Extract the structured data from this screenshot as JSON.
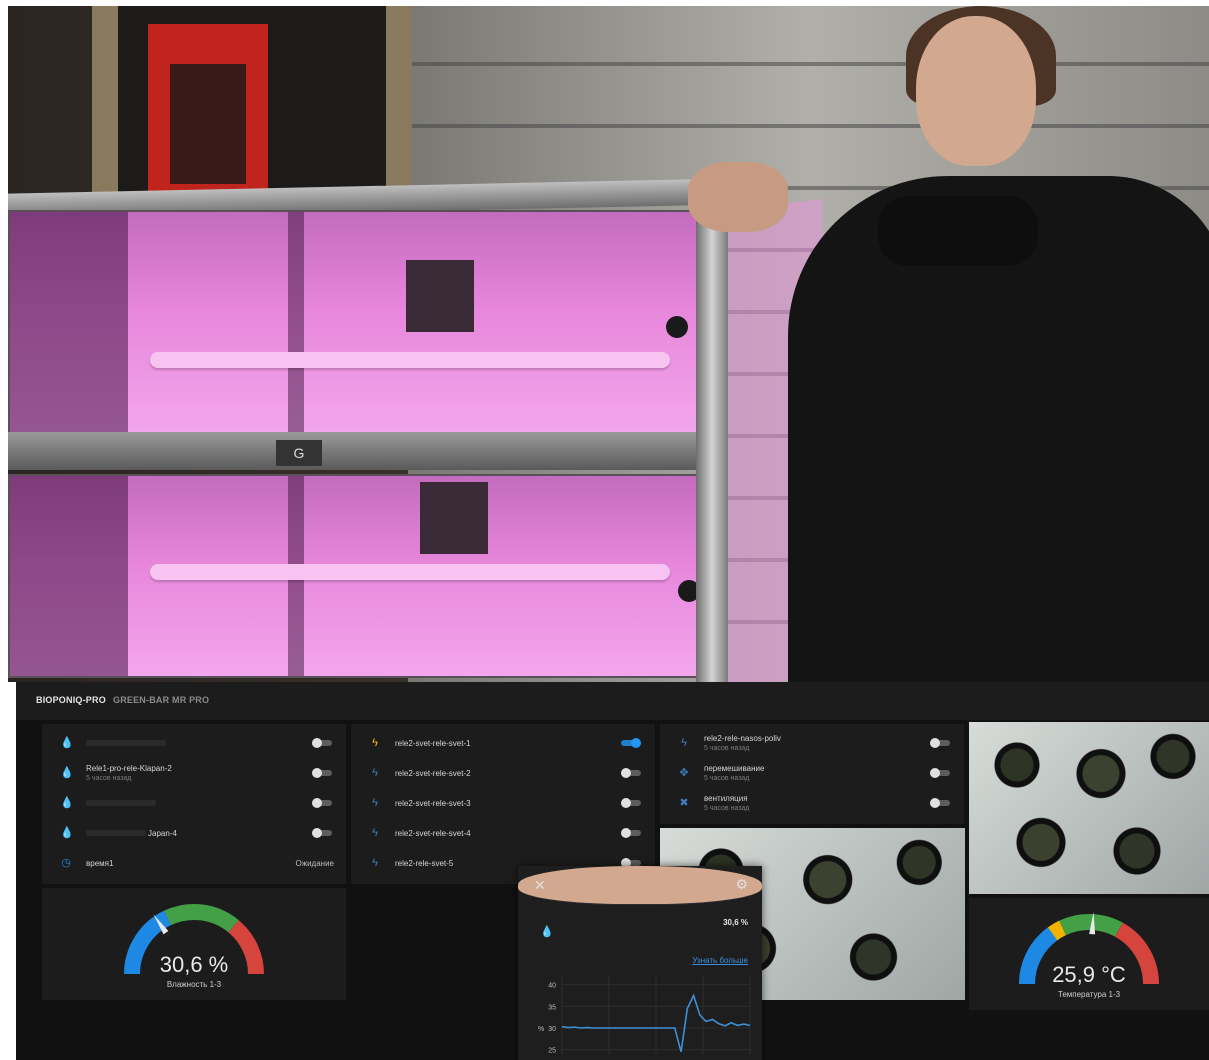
{
  "tabs": [
    "BIOPONIQ-PRO",
    "GREEN-BAR MR PRO"
  ],
  "card1": {
    "rows": [
      {
        "name": "",
        "sub": "",
        "icon": "water-drop-icon",
        "on": false
      },
      {
        "name": "Rele1-pro-rele-Klapan-2",
        "sub": "5 часов назад",
        "icon": "water-drop-icon",
        "on": false
      },
      {
        "name": "",
        "sub": "",
        "icon": "water-drop-icon",
        "on": false
      },
      {
        "name": "Japan-4",
        "sub": "",
        "icon": "water-drop-icon",
        "on": false
      }
    ],
    "timer": {
      "name": "время1",
      "state": "Ожидание",
      "icon": "timer-icon"
    }
  },
  "card2": {
    "rows": [
      {
        "name": "rele2-svet-rele-svet-1",
        "on": true,
        "icon": "flash-icon"
      },
      {
        "name": "rele2-svet-rele-svet-2",
        "on": false,
        "icon": "flash-icon"
      },
      {
        "name": "rele2-svet-rele-svet-3",
        "on": false,
        "icon": "flash-icon"
      },
      {
        "name": "rele2-svet-rele-svet-4",
        "on": false,
        "icon": "flash-icon"
      },
      {
        "name": "rele2-rele-svet-5",
        "on": false,
        "icon": "flash-icon"
      }
    ]
  },
  "card3": {
    "rows": [
      {
        "name": "rele2-rele-nasos-poliv",
        "sub": "5 часов назад",
        "icon": "water-pump-icon",
        "on": false
      },
      {
        "name": "перемешивание",
        "sub": "5 часов назад",
        "icon": "mixer-icon",
        "on": false
      },
      {
        "name": "вентиляция",
        "sub": "5 часов назад",
        "icon": "fan-icon",
        "on": false
      }
    ]
  },
  "humidity": {
    "value": "30,6 %",
    "label": "Влажность 1-3",
    "fraction": 0.31
  },
  "temperature": {
    "value": "25,9 °C",
    "label": "Температура 1-3",
    "fraction": 0.52
  },
  "dialog": {
    "value": "30,6 %",
    "more_link": "Узнать больше",
    "y_axis_label": "%",
    "close_icon": "close-icon",
    "settings_icon": "gear-icon"
  },
  "chart_data": {
    "type": "line",
    "title": "",
    "ylabel": "%",
    "y_ticks": [
      40,
      35,
      30,
      25
    ],
    "ylim": [
      24,
      42
    ],
    "series": [
      {
        "name": "",
        "values": [
          30.3,
          30.1,
          30.2,
          30.0,
          30.1,
          30.0,
          30.0,
          30.0,
          30.0,
          30.0,
          30.0,
          30.0,
          30.0,
          30.0,
          30.0,
          30.0,
          30.0,
          30.0,
          30.0,
          24.5,
          34.5,
          37.5,
          33.0,
          31.5,
          32.0,
          31.0,
          30.5,
          31.2,
          30.6,
          30.9,
          30.6
        ]
      }
    ]
  },
  "colors": {
    "accent": "#2196f3",
    "gauge_blue": "#1e88e5",
    "gauge_green": "#43a047",
    "gauge_red": "#d6453d",
    "gauge_yellow": "#f0b400"
  }
}
